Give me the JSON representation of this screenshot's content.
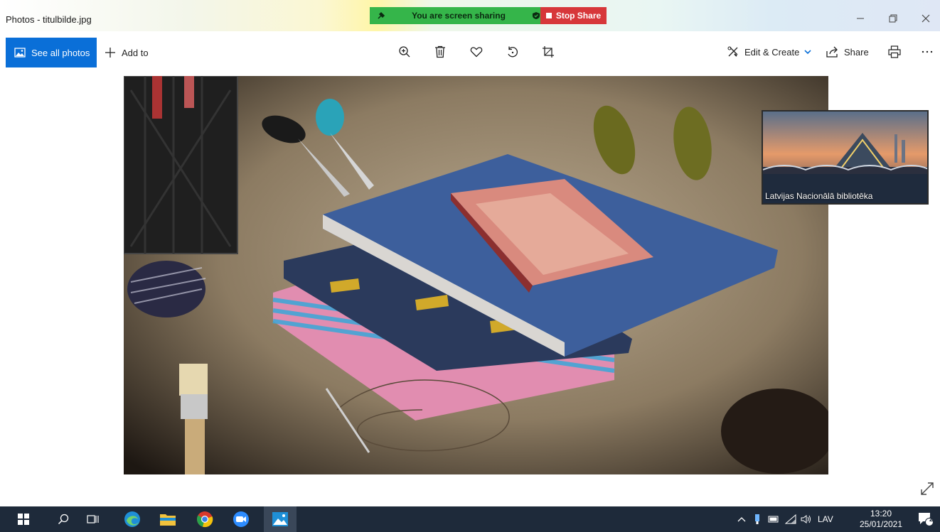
{
  "window": {
    "title": "Photos - titulbilde.jpg"
  },
  "screen_share": {
    "status_text": "You are screen sharing",
    "stop_label": "Stop Share",
    "status_color": "#35b54a",
    "stop_color": "#d7373a"
  },
  "toolbar": {
    "see_all_label": "See all photos",
    "add_to_label": "Add to",
    "icons": [
      "zoom-in-icon",
      "delete-icon",
      "favorite-icon",
      "rotate-icon",
      "crop-icon"
    ],
    "edit_create_label": "Edit & Create",
    "share_label": "Share",
    "accent_color": "#0a6fd8"
  },
  "preview": {
    "caption": "Latvijas Nacionālā bibliotēka"
  },
  "taskbar": {
    "apps": [
      "start-icon",
      "search-icon",
      "task-view-icon",
      "edge-icon",
      "file-explorer-icon",
      "chrome-icon",
      "zoom-icon",
      "photos-icon"
    ],
    "language": "LAV",
    "time": "13:20",
    "date": "25/01/2021",
    "notification_count": "2"
  }
}
